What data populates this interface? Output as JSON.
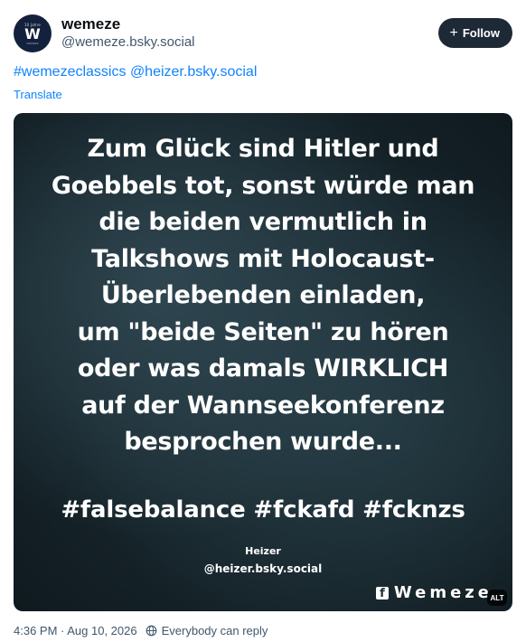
{
  "author": {
    "display_name": "wemeze",
    "handle": "@wemeze.bsky.social",
    "avatar": {
      "top_text": "10 Jahre",
      "mark": "W",
      "sub_text": "WEMEZE"
    }
  },
  "follow_button": {
    "icon": "plus-icon",
    "label": "Follow"
  },
  "post": {
    "hashtag": "#wemezeclassics",
    "mention": "@heizer.bsky.social",
    "translate_label": "Translate"
  },
  "image": {
    "lines": [
      "Zum Glück sind Hitler und",
      "Goebbels tot, sonst würde man",
      "die beiden vermutlich in",
      "Talkshows mit Holocaust-",
      "Überlebenden einladen,",
      "um \"beide Seiten\" zu hören",
      "oder was damals WIRKLICH",
      "auf der Wannseekonferenz",
      "besprochen wurde..."
    ],
    "hashtags": "#falsebalance #fckafd #fcknzs",
    "credit_name": "Heizer",
    "credit_handle": "@heizer.bsky.social",
    "watermark_icon": "facebook-icon",
    "watermark_text": "Wemeze",
    "alt_badge": "ALT"
  },
  "footer": {
    "timestamp": "4:36 PM · Aug 10, 2026",
    "reply_icon": "globe-icon",
    "reply_setting": "Everybody can reply"
  },
  "colors": {
    "link": "#1083fe",
    "follow_bg": "#1e2936",
    "muted": "#42576c"
  }
}
